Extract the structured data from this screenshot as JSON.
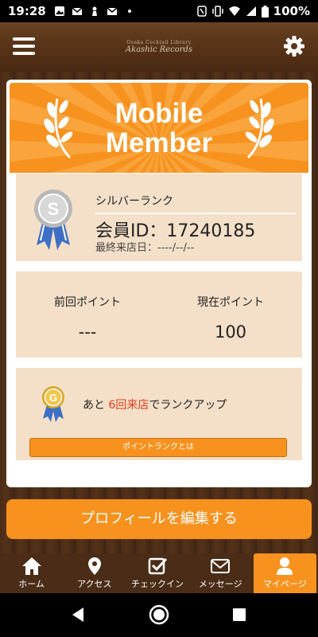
{
  "status_bar": {
    "time": "19:28",
    "battery": "100%"
  },
  "header": {
    "logo_sub": "Osaka Cocktail Library",
    "logo_main": "Akashic Records"
  },
  "banner": {
    "title_line1": "Mobile",
    "title_line2": "Member"
  },
  "rank": {
    "name": "シルバーランク",
    "medal_letter": "S",
    "member_id": "会員ID：17240185",
    "last_visit": "最終来店日：----/--/--"
  },
  "points": {
    "prev_label": "前回ポイント",
    "prev_value": "---",
    "curr_label": "現在ポイント",
    "curr_value": "100"
  },
  "rankup": {
    "medal_letter": "G",
    "msg_prefix": "あと ",
    "msg_highlight": "6回来店",
    "msg_suffix": "でランクアップ",
    "info_button": "ポイントランクとは"
  },
  "edit_button": "プロフィールを編集する",
  "tabs": [
    {
      "label": "ホーム",
      "icon": "home-icon"
    },
    {
      "label": "アクセス",
      "icon": "map-pin-icon"
    },
    {
      "label": "チェックイン",
      "icon": "checkbox-icon"
    },
    {
      "label": "メッセージ",
      "icon": "mail-icon"
    },
    {
      "label": "マイページ",
      "icon": "user-icon",
      "active": true
    }
  ],
  "colors": {
    "accent": "#f7921e",
    "panel": "#f4dfc8",
    "wood": "#4a2c17",
    "highlight": "#e53b1d"
  }
}
